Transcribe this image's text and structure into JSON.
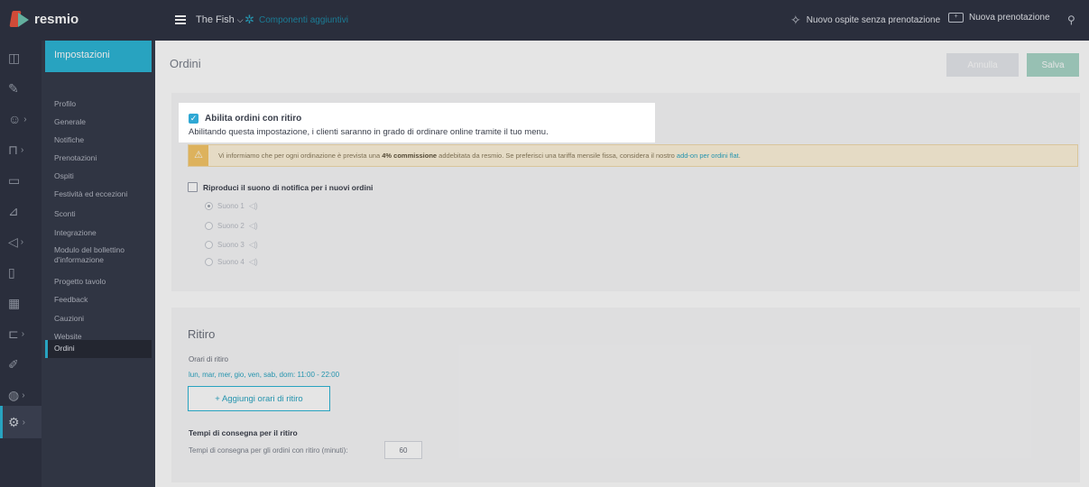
{
  "app": {
    "name": "resmio"
  },
  "topbar": {
    "venue": "The Fish",
    "components_label": "Componenti aggiuntivi",
    "walkin_label": "Nuovo ospite senza prenotazione",
    "new_reservation_label": "Nuova prenotazione"
  },
  "sidebar": {
    "header": "Impostazioni",
    "items": [
      {
        "label": "Profilo"
      },
      {
        "label": "Generale"
      },
      {
        "label": "Notifiche"
      },
      {
        "label": "Prenotazioni"
      },
      {
        "label": "Ospiti"
      },
      {
        "label": "Festività ed eccezioni"
      },
      {
        "label": "Sconti"
      },
      {
        "label": "Integrazione"
      },
      {
        "label": "Modulo del bollettino d'informazione"
      },
      {
        "label": "Progetto tavolo"
      },
      {
        "label": "Feedback"
      },
      {
        "label": "Cauzioni"
      },
      {
        "label": "Website"
      },
      {
        "label": "Ordini"
      }
    ]
  },
  "page": {
    "title": "Ordini",
    "cancel_label": "Annulla",
    "save_label": "Salva"
  },
  "orders": {
    "enable_pickup_label": "Abilita ordini con ritiro",
    "enable_pickup_desc": "Abilitando questa impostazione, i clienti saranno in grado di ordinare online tramite il tuo menu.",
    "enable_pickup_checked": true,
    "warning_prefix": "Vi informiamo che per ogni ordinazione è prevista una ",
    "warning_bold": "4% commissione",
    "warning_middle": " addebitata da resmio. Se preferisci una tariffa mensile fissa, considera il nostro ",
    "warning_link": "add-on per ordini flat",
    "warning_suffix": ".",
    "notify_label": "Riproduci il suono di notifica per i nuovi ordini",
    "sounds": [
      {
        "label": "Suono 1",
        "selected": true
      },
      {
        "label": "Suono 2",
        "selected": false
      },
      {
        "label": "Suono 3",
        "selected": false
      },
      {
        "label": "Suono 4",
        "selected": false
      }
    ]
  },
  "pickup": {
    "title": "Ritiro",
    "hours_label": "Orari di ritiro",
    "hours_value": "lun, mar, mer, gio, ven, sab, dom: 11:00 - 22:00",
    "add_hours_label": "+ Aggiungi orari di ritiro",
    "delivery_title": "Tempi di consegna per il ritiro",
    "delivery_label": "Tempi di consegna per gli ordini con ritiro (minuti):",
    "delivery_value": "60"
  },
  "colors": {
    "topbar": "#2f3443",
    "sidebar": "#363b4b",
    "accent": "#2db6d6",
    "save": "#a9d6c8",
    "warning_bg": "#fff4dc"
  }
}
